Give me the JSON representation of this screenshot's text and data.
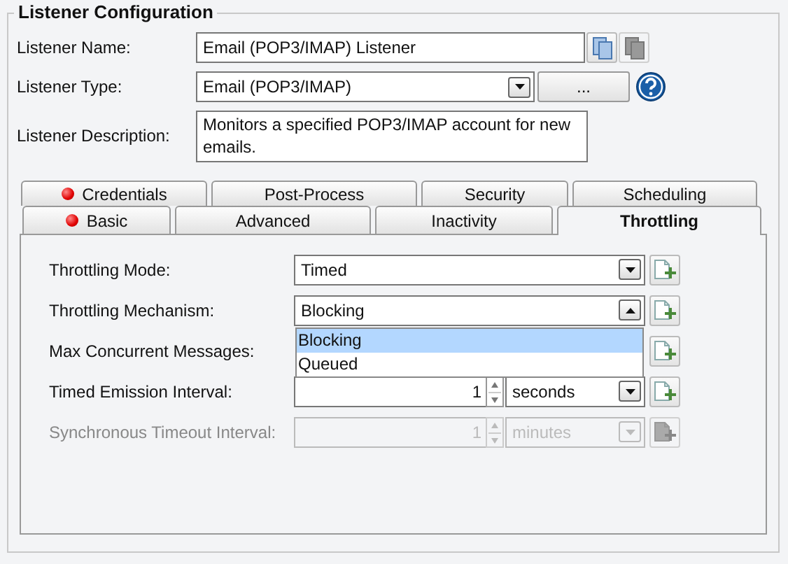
{
  "group_title": "Listener Configuration",
  "name_field": {
    "label": "Listener Name:",
    "value": "Email (POP3/IMAP) Listener",
    "copy_enabled": true,
    "paste_enabled": false
  },
  "type_field": {
    "label": "Listener Type:",
    "value": "Email (POP3/IMAP)",
    "button": "..."
  },
  "description_field": {
    "label": "Listener Description:",
    "value": "Monitors a specified POP3/IMAP account for new emails."
  },
  "tab_rows": [
    [
      {
        "label": "Credentials",
        "selected": false,
        "error": true
      },
      {
        "label": "Post-Process",
        "selected": false,
        "error": false
      },
      {
        "label": "Security",
        "selected": false,
        "error": false
      },
      {
        "label": "Scheduling",
        "selected": false,
        "error": false
      }
    ],
    [
      {
        "label": "Basic",
        "selected": false,
        "error": true
      },
      {
        "label": "Advanced",
        "selected": false,
        "error": false
      },
      {
        "label": "Inactivity",
        "selected": false,
        "error": false
      },
      {
        "label": "Throttling",
        "selected": true,
        "error": false
      }
    ]
  ],
  "settings": [
    {
      "label": "Throttling Mode:",
      "kind": "combo",
      "value": "Timed",
      "open": false,
      "disabled": false
    },
    {
      "label": "Throttling Mechanism:",
      "kind": "combo",
      "value": "Blocking",
      "open": true,
      "disabled": false,
      "options": [
        {
          "label": "Blocking",
          "selected": true
        },
        {
          "label": "Queued",
          "selected": false
        }
      ]
    },
    {
      "label": "Max Concurrent Messages:",
      "kind": "covered",
      "disabled": false
    },
    {
      "label": "Timed Emission Interval:",
      "kind": "spinner",
      "value": "1",
      "unit": "seconds",
      "disabled": false
    },
    {
      "label": "Synchronous Timeout Interval:",
      "kind": "spinner",
      "value": "1",
      "unit": "minutes",
      "disabled": true
    }
  ]
}
